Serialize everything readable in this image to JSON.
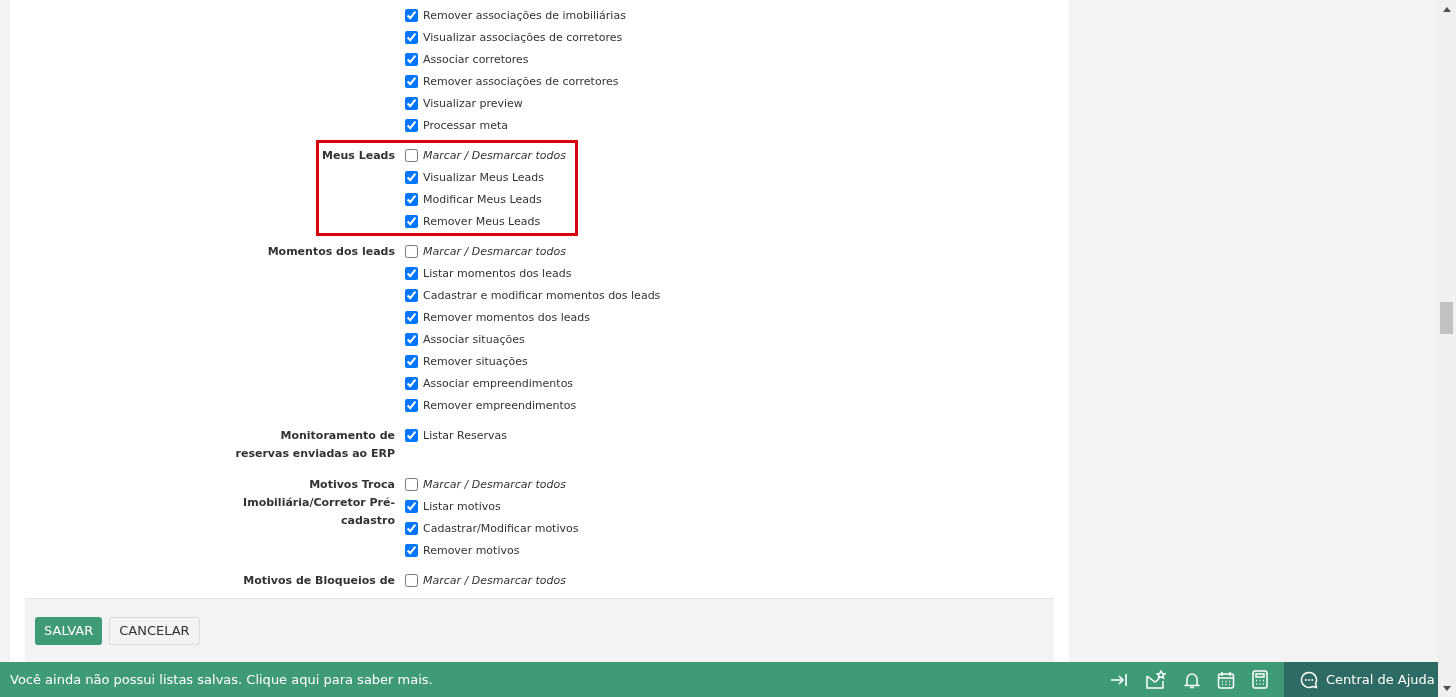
{
  "permission_groups": [
    {
      "highlighted": false,
      "items": [
        {
          "kind": "permission",
          "label": "Remover associações de imobiliárias",
          "checked": true
        },
        {
          "kind": "permission",
          "label": "Visualizar associações de corretores",
          "checked": true
        },
        {
          "kind": "permission",
          "label": "Associar corretores",
          "checked": true
        },
        {
          "kind": "permission",
          "label": "Remover associações de corretores",
          "checked": true
        },
        {
          "kind": "permission",
          "label": "Visualizar preview",
          "checked": true
        },
        {
          "kind": "permission",
          "label": "Processar meta",
          "checked": true
        }
      ]
    },
    {
      "label": "Meus Leads",
      "highlighted": true,
      "items": [
        {
          "kind": "toggle_all",
          "label": "Marcar / Desmarcar todos",
          "checked": false
        },
        {
          "kind": "permission",
          "label": "Visualizar Meus Leads",
          "checked": true
        },
        {
          "kind": "permission",
          "label": "Modificar Meus Leads",
          "checked": true
        },
        {
          "kind": "permission",
          "label": "Remover Meus Leads",
          "checked": true
        }
      ]
    },
    {
      "label": "Momentos dos leads",
      "highlighted": false,
      "items": [
        {
          "kind": "toggle_all",
          "label": "Marcar / Desmarcar todos",
          "checked": false
        },
        {
          "kind": "permission",
          "label": "Listar momentos dos leads",
          "checked": true
        },
        {
          "kind": "permission",
          "label": "Cadastrar e modificar momentos dos leads",
          "checked": true
        },
        {
          "kind": "permission",
          "label": "Remover momentos dos leads",
          "checked": true
        },
        {
          "kind": "permission",
          "label": "Associar situações",
          "checked": true
        },
        {
          "kind": "permission",
          "label": "Remover situações",
          "checked": true
        },
        {
          "kind": "permission",
          "label": "Associar empreendimentos",
          "checked": true
        },
        {
          "kind": "permission",
          "label": "Remover empreendimentos",
          "checked": true
        }
      ]
    },
    {
      "label": "Monitoramento de reservas enviadas ao ERP",
      "highlighted": false,
      "items": [
        {
          "kind": "permission",
          "label": "Listar Reservas",
          "checked": true
        }
      ]
    },
    {
      "label": "Motivos Troca Imobiliária/Corretor Pré-cadastro",
      "highlighted": false,
      "items": [
        {
          "kind": "toggle_all",
          "label": "Marcar / Desmarcar todos",
          "checked": false
        },
        {
          "kind": "permission",
          "label": "Listar motivos",
          "checked": true
        },
        {
          "kind": "permission",
          "label": "Cadastrar/Modificar motivos",
          "checked": true
        },
        {
          "kind": "permission",
          "label": "Remover motivos",
          "checked": true
        }
      ]
    },
    {
      "label": "Motivos de Bloqueios de",
      "highlighted": false,
      "items": [
        {
          "kind": "toggle_all",
          "label": "Marcar / Desmarcar todos",
          "checked": false
        }
      ]
    }
  ],
  "form_actions": [
    {
      "kind": "primary",
      "label": "SALVAR"
    },
    {
      "kind": "secondary",
      "label": "CANCELAR"
    }
  ],
  "status_bar": {
    "message": "Você ainda não possui listas salvas. Clique aqui para saber mais.",
    "help": "Central de Ajuda"
  }
}
